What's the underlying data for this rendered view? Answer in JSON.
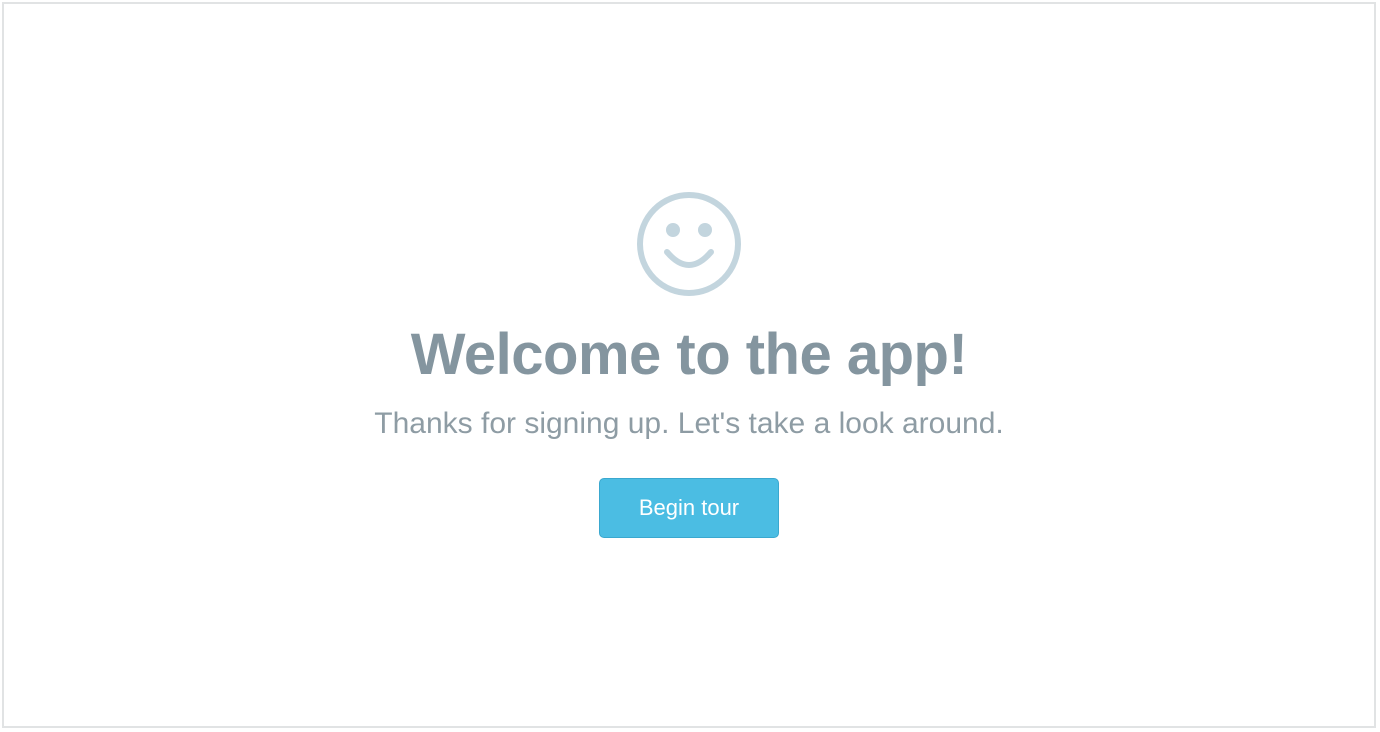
{
  "welcome": {
    "icon": "smiley-face-icon",
    "title": "Welcome to the app!",
    "subtitle": "Thanks for signing up. Let's take a look around.",
    "begin_label": "Begin tour"
  },
  "colors": {
    "icon": "#c3d5de",
    "title": "#84959f",
    "subtitle": "#8e9ca4",
    "button": "#4bbde3",
    "button_text": "#ffffff",
    "border": "#e1e3e4"
  }
}
